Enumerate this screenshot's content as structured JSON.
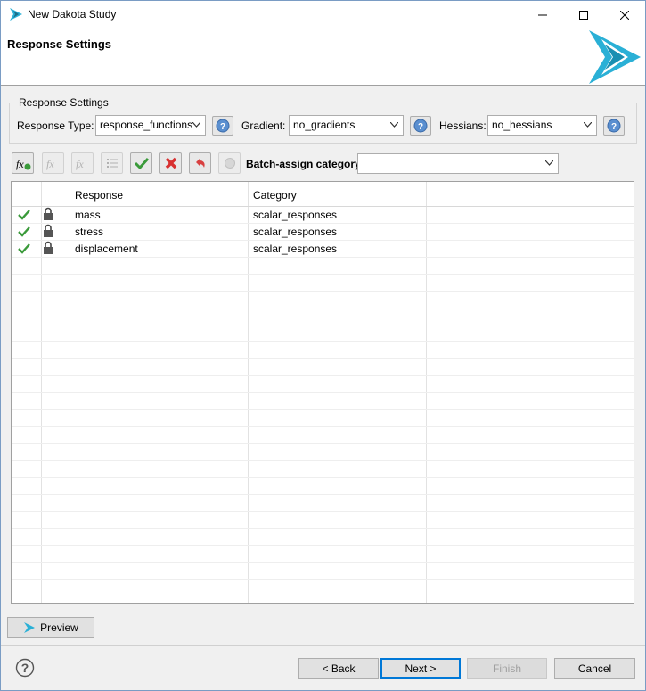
{
  "window": {
    "title": "New Dakota Study"
  },
  "banner": {
    "title": "Response Settings"
  },
  "settings": {
    "group_label": "Response Settings",
    "response_type_label": "Response Type:",
    "response_type_value": "response_functions",
    "gradient_label": "Gradient:",
    "gradient_value": "no_gradients",
    "hessians_label": "Hessians:",
    "hessians_value": "no_hessians"
  },
  "toolbar": {
    "batch_label": "Batch-assign category:",
    "batch_value": "",
    "fx_label": "fx"
  },
  "table": {
    "headers": [
      "Response",
      "Category"
    ],
    "rows": [
      {
        "response": "mass",
        "category": "scalar_responses"
      },
      {
        "response": "stress",
        "category": "scalar_responses"
      },
      {
        "response": "displacement",
        "category": "scalar_responses"
      }
    ]
  },
  "buttons": {
    "preview": "Preview",
    "back": "< Back",
    "next": "Next >",
    "finish": "Finish",
    "cancel": "Cancel"
  },
  "colors": {
    "accent": "#0078d7",
    "logo": "#2ab0d6",
    "check": "#3a9a3a",
    "delete": "#d83030"
  }
}
